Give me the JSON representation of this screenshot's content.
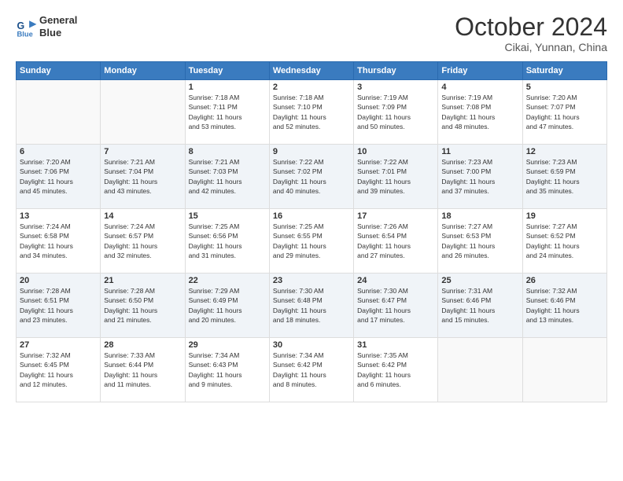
{
  "logo": {
    "line1": "General",
    "line2": "Blue"
  },
  "title": "October 2024",
  "subtitle": "Cikai, Yunnan, China",
  "header_days": [
    "Sunday",
    "Monday",
    "Tuesday",
    "Wednesday",
    "Thursday",
    "Friday",
    "Saturday"
  ],
  "weeks": [
    [
      {
        "day": "",
        "info": ""
      },
      {
        "day": "",
        "info": ""
      },
      {
        "day": "1",
        "info": "Sunrise: 7:18 AM\nSunset: 7:11 PM\nDaylight: 11 hours\nand 53 minutes."
      },
      {
        "day": "2",
        "info": "Sunrise: 7:18 AM\nSunset: 7:10 PM\nDaylight: 11 hours\nand 52 minutes."
      },
      {
        "day": "3",
        "info": "Sunrise: 7:19 AM\nSunset: 7:09 PM\nDaylight: 11 hours\nand 50 minutes."
      },
      {
        "day": "4",
        "info": "Sunrise: 7:19 AM\nSunset: 7:08 PM\nDaylight: 11 hours\nand 48 minutes."
      },
      {
        "day": "5",
        "info": "Sunrise: 7:20 AM\nSunset: 7:07 PM\nDaylight: 11 hours\nand 47 minutes."
      }
    ],
    [
      {
        "day": "6",
        "info": "Sunrise: 7:20 AM\nSunset: 7:06 PM\nDaylight: 11 hours\nand 45 minutes."
      },
      {
        "day": "7",
        "info": "Sunrise: 7:21 AM\nSunset: 7:04 PM\nDaylight: 11 hours\nand 43 minutes."
      },
      {
        "day": "8",
        "info": "Sunrise: 7:21 AM\nSunset: 7:03 PM\nDaylight: 11 hours\nand 42 minutes."
      },
      {
        "day": "9",
        "info": "Sunrise: 7:22 AM\nSunset: 7:02 PM\nDaylight: 11 hours\nand 40 minutes."
      },
      {
        "day": "10",
        "info": "Sunrise: 7:22 AM\nSunset: 7:01 PM\nDaylight: 11 hours\nand 39 minutes."
      },
      {
        "day": "11",
        "info": "Sunrise: 7:23 AM\nSunset: 7:00 PM\nDaylight: 11 hours\nand 37 minutes."
      },
      {
        "day": "12",
        "info": "Sunrise: 7:23 AM\nSunset: 6:59 PM\nDaylight: 11 hours\nand 35 minutes."
      }
    ],
    [
      {
        "day": "13",
        "info": "Sunrise: 7:24 AM\nSunset: 6:58 PM\nDaylight: 11 hours\nand 34 minutes."
      },
      {
        "day": "14",
        "info": "Sunrise: 7:24 AM\nSunset: 6:57 PM\nDaylight: 11 hours\nand 32 minutes."
      },
      {
        "day": "15",
        "info": "Sunrise: 7:25 AM\nSunset: 6:56 PM\nDaylight: 11 hours\nand 31 minutes."
      },
      {
        "day": "16",
        "info": "Sunrise: 7:25 AM\nSunset: 6:55 PM\nDaylight: 11 hours\nand 29 minutes."
      },
      {
        "day": "17",
        "info": "Sunrise: 7:26 AM\nSunset: 6:54 PM\nDaylight: 11 hours\nand 27 minutes."
      },
      {
        "day": "18",
        "info": "Sunrise: 7:27 AM\nSunset: 6:53 PM\nDaylight: 11 hours\nand 26 minutes."
      },
      {
        "day": "19",
        "info": "Sunrise: 7:27 AM\nSunset: 6:52 PM\nDaylight: 11 hours\nand 24 minutes."
      }
    ],
    [
      {
        "day": "20",
        "info": "Sunrise: 7:28 AM\nSunset: 6:51 PM\nDaylight: 11 hours\nand 23 minutes."
      },
      {
        "day": "21",
        "info": "Sunrise: 7:28 AM\nSunset: 6:50 PM\nDaylight: 11 hours\nand 21 minutes."
      },
      {
        "day": "22",
        "info": "Sunrise: 7:29 AM\nSunset: 6:49 PM\nDaylight: 11 hours\nand 20 minutes."
      },
      {
        "day": "23",
        "info": "Sunrise: 7:30 AM\nSunset: 6:48 PM\nDaylight: 11 hours\nand 18 minutes."
      },
      {
        "day": "24",
        "info": "Sunrise: 7:30 AM\nSunset: 6:47 PM\nDaylight: 11 hours\nand 17 minutes."
      },
      {
        "day": "25",
        "info": "Sunrise: 7:31 AM\nSunset: 6:46 PM\nDaylight: 11 hours\nand 15 minutes."
      },
      {
        "day": "26",
        "info": "Sunrise: 7:32 AM\nSunset: 6:46 PM\nDaylight: 11 hours\nand 13 minutes."
      }
    ],
    [
      {
        "day": "27",
        "info": "Sunrise: 7:32 AM\nSunset: 6:45 PM\nDaylight: 11 hours\nand 12 minutes."
      },
      {
        "day": "28",
        "info": "Sunrise: 7:33 AM\nSunset: 6:44 PM\nDaylight: 11 hours\nand 11 minutes."
      },
      {
        "day": "29",
        "info": "Sunrise: 7:34 AM\nSunset: 6:43 PM\nDaylight: 11 hours\nand 9 minutes."
      },
      {
        "day": "30",
        "info": "Sunrise: 7:34 AM\nSunset: 6:42 PM\nDaylight: 11 hours\nand 8 minutes."
      },
      {
        "day": "31",
        "info": "Sunrise: 7:35 AM\nSunset: 6:42 PM\nDaylight: 11 hours\nand 6 minutes."
      },
      {
        "day": "",
        "info": ""
      },
      {
        "day": "",
        "info": ""
      }
    ]
  ]
}
